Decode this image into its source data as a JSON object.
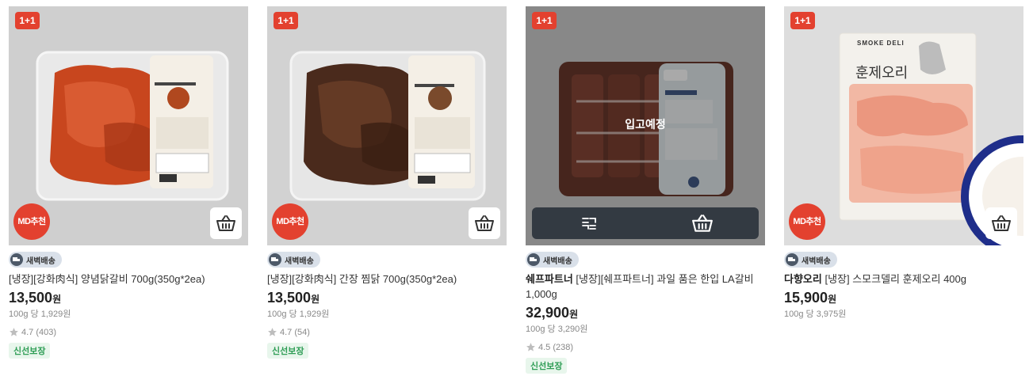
{
  "products": [
    {
      "promo_badge": "1+1",
      "md_badge": "MD추천",
      "cart_icon": "basket-icon",
      "delivery": "새벽배송",
      "brand": "",
      "title": "[냉장][강화肉식] 양념닭갈비 700g(350g*2ea)",
      "price": "13,500",
      "currency": "원",
      "unit_price": "100g 당 1,929원",
      "rating": "4.7",
      "reviews": "(403)",
      "tag": "신선보장"
    },
    {
      "promo_badge": "1+1",
      "md_badge": "MD추천",
      "cart_icon": "basket-icon",
      "delivery": "새벽배송",
      "brand": "",
      "title": "[냉장][강화肉식] 간장 찜닭 700g(350g*2ea)",
      "price": "13,500",
      "currency": "원",
      "unit_price": "100g 당 1,929원",
      "rating": "4.7",
      "reviews": "(54)",
      "tag": "신선보장"
    },
    {
      "promo_badge": "1+1",
      "status_overlay": "입고예정",
      "compare_icon": "compare-icon",
      "cart_icon": "basket-icon",
      "delivery": "새벽배송",
      "brand": "쉐프파트너",
      "title": " [냉장][쉐프파트너] 과일 품은 한입 LA갈비 1,000g",
      "price": "32,900",
      "currency": "원",
      "unit_price": "100g 당 3,290원",
      "rating": "4.5",
      "reviews": "(238)",
      "tag": "신선보장"
    },
    {
      "promo_badge": "1+1",
      "md_badge": "MD추천",
      "cart_icon": "basket-icon",
      "delivery": "새벽배송",
      "brand": "다향오리",
      "title": " [냉장] 스모크델리 훈제오리 400g",
      "price": "15,900",
      "currency": "원",
      "unit_price": "100g 당 3,975원",
      "package_text": {
        "brand_en": "SMOKE DELI",
        "name_ko": "훈제오리"
      }
    }
  ],
  "colors": {
    "promo_red": "#e3412f",
    "fresh_green": "#2e9d55"
  }
}
